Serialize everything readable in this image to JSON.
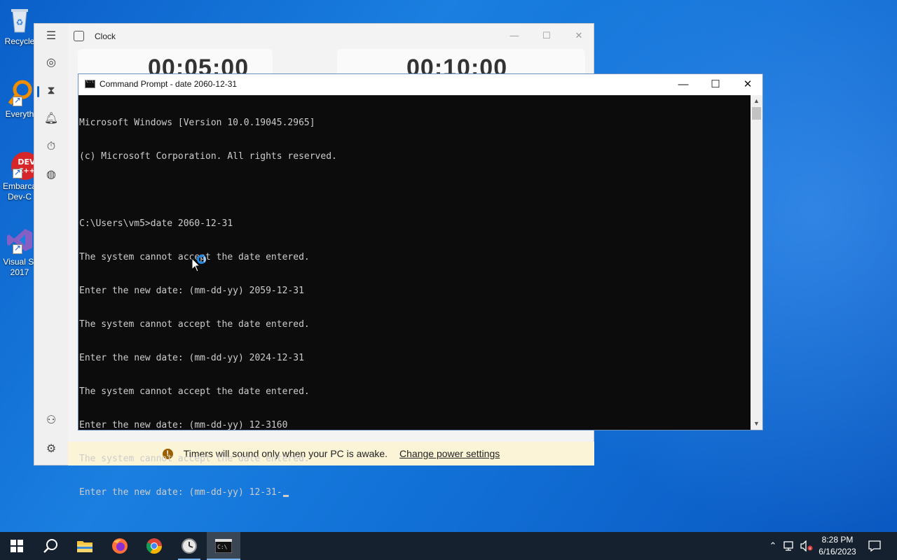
{
  "desktop": {
    "icons": [
      {
        "label": "Recycle",
        "icon": "recycle-bin-icon"
      },
      {
        "label": "Everyth",
        "icon": "everything-search-icon"
      },
      {
        "label": "Embarca",
        "label2": "Dev-C",
        "icon": "devcpp-icon"
      },
      {
        "label": "Visual St",
        "label2": "2017",
        "icon": "visual-studio-icon"
      }
    ]
  },
  "clock_app": {
    "title": "Clock",
    "timers": [
      "00:05:00",
      "00:10:00"
    ],
    "notice_text": "Timers will sound only when your PC is awake.",
    "notice_link": "Change power settings",
    "nav_icons": [
      "hamburger-menu-icon",
      "focus-sessions-icon",
      "timer-icon",
      "alarm-icon",
      "stopwatch-icon",
      "world-clock-icon",
      "account-icon",
      "settings-icon"
    ]
  },
  "cmd": {
    "title": "Command Prompt - date  2060-12-31",
    "lines": [
      "Microsoft Windows [Version 10.0.19045.2965]",
      "(c) Microsoft Corporation. All rights reserved.",
      "",
      "C:\\Users\\vm5>date 2060-12-31",
      "The system cannot accept the date entered.",
      "Enter the new date: (mm-dd-yy) 2059-12-31",
      "The system cannot accept the date entered.",
      "Enter the new date: (mm-dd-yy) 2024-12-31",
      "The system cannot accept the date entered.",
      "Enter the new date: (mm-dd-yy) 12-3160",
      "The system cannot accept the date entered.",
      "Enter the new date: (mm-dd-yy) 12-31-"
    ]
  },
  "taskbar": {
    "apps": [
      "start-icon",
      "search-icon",
      "file-explorer-icon",
      "firefox-icon",
      "chrome-icon",
      "clock-app-icon",
      "command-prompt-icon"
    ],
    "time": "8:28 PM",
    "date": "6/16/2023"
  },
  "colors": {
    "accent": "#0a64c8",
    "cmd_bg": "#0c0c0c",
    "cmd_fg": "#cccccc",
    "notice_bg": "#fcf4d6",
    "taskbar": "#15212f"
  }
}
